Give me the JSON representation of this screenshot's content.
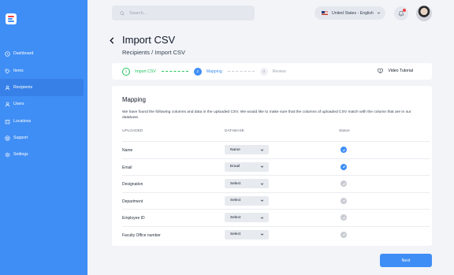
{
  "sidebar": {
    "items": [
      {
        "label": "Dashboard",
        "icon": "clock-icon"
      },
      {
        "label": "Items",
        "icon": "tag-icon"
      },
      {
        "label": "Recipients",
        "icon": "user-icon"
      },
      {
        "label": "Users",
        "icon": "user-icon"
      },
      {
        "label": "Locations",
        "icon": "building-icon"
      },
      {
        "label": "Support",
        "icon": "lifebuoy-icon"
      },
      {
        "label": "Settings",
        "icon": "gear-icon"
      }
    ],
    "active": "Recipients"
  },
  "topbar": {
    "search_placeholder": "Search...",
    "language": "United States - English"
  },
  "header": {
    "title": "Import CSV",
    "breadcrumb": "Recipients / Import CSV"
  },
  "stepper": {
    "steps": [
      {
        "num": "1",
        "label": "Import CSV",
        "state": "done"
      },
      {
        "num": "2",
        "label": "Mapping",
        "state": "current"
      },
      {
        "num": "3",
        "label": "Review",
        "state": "todo"
      }
    ],
    "video_label": "Video Tutorial"
  },
  "mapping": {
    "title": "Mapping",
    "description": "We have found the following columns and data in the uploaded CSV. We would like to make sure that the columns of uploaded CSV match with the column that are in our database.",
    "columns": {
      "uploaded": "UPLOADED",
      "database": "DATABASE",
      "status": "Status"
    },
    "rows": [
      {
        "uploaded": "Name",
        "database": "Name",
        "mapped": true
      },
      {
        "uploaded": "Email",
        "database": "Email",
        "mapped": true
      },
      {
        "uploaded": "Designation",
        "database": "Select",
        "mapped": false
      },
      {
        "uploaded": "Department",
        "database": "Select",
        "mapped": false
      },
      {
        "uploaded": "Employee ID",
        "database": "Select",
        "mapped": false
      },
      {
        "uploaded": "Faculty Office number",
        "database": "Select",
        "mapped": false
      }
    ]
  },
  "next_label": "Next",
  "colors": {
    "accent": "#3f8ef5",
    "success": "#22c55e",
    "sidebar": "#3f8ef5"
  }
}
